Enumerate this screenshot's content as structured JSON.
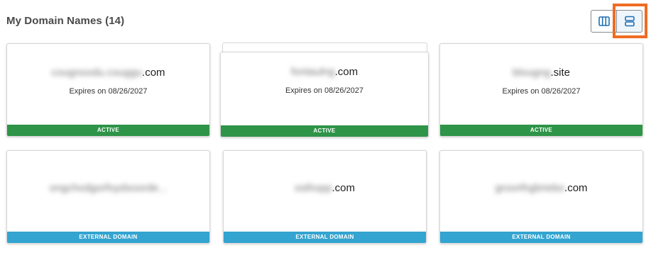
{
  "header": {
    "title": "My Domain Names (14)"
  },
  "view_toggle": {
    "options": [
      {
        "name": "grid-view",
        "icon": "columns-icon",
        "selected": false
      },
      {
        "name": "list-view",
        "icon": "rows-icon",
        "selected": true
      }
    ]
  },
  "colors": {
    "active": "#2e9448",
    "external": "#34a4d0",
    "highlight": "#ef6c23",
    "icon_blue": "#1f6fb4"
  },
  "domains": [
    {
      "blurred": "cougnoodu.couggu",
      "suffix": ".com",
      "expires": "Expires on 08/26/2027",
      "status": "ACTIVE"
    },
    {
      "blurred": "fontaulng",
      "suffix": ".com",
      "expires": "Expires on 08/26/2027",
      "status": "ACTIVE"
    },
    {
      "blurred": "blougng",
      "suffix": ".site",
      "expires": "Expires on 08/26/2027",
      "status": "ACTIVE"
    },
    {
      "blurred": "ongchodgorfoydsoorde...",
      "suffix": "",
      "expires": "",
      "status": "EXTERNAL DOMAIN"
    },
    {
      "blurred": "ssthopp",
      "suffix": ".com",
      "expires": "",
      "status": "EXTERNAL DOMAIN"
    },
    {
      "blurred": "groorthgbriebo",
      "suffix": ".com",
      "expires": "",
      "status": "EXTERNAL DOMAIN"
    }
  ]
}
